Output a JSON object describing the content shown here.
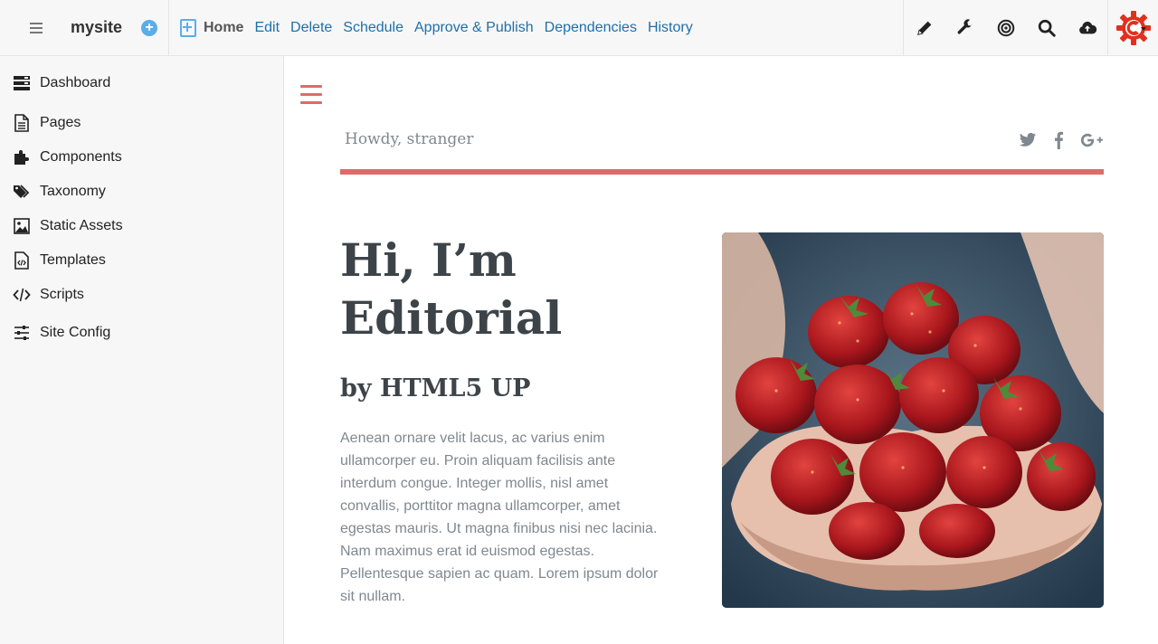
{
  "toolbar": {
    "site_name": "mysite",
    "add_symbol": "+",
    "page_label": "Home",
    "actions": [
      "Edit",
      "Delete",
      "Schedule",
      "Approve & Publish",
      "Dependencies",
      "History"
    ],
    "icons": [
      "pencil-icon",
      "wrench-icon",
      "target-icon",
      "search-icon",
      "cloud-upload-icon"
    ],
    "accent": "#1f6fa8"
  },
  "sidebar": {
    "items": [
      {
        "label": "Dashboard",
        "icon": "dashboard-icon"
      },
      {
        "label": "Pages",
        "icon": "page-icon"
      },
      {
        "label": "Components",
        "icon": "puzzle-icon"
      },
      {
        "label": "Taxonomy",
        "icon": "tags-icon"
      },
      {
        "label": "Static Assets",
        "icon": "image-icon"
      },
      {
        "label": "Templates",
        "icon": "code-file-icon"
      },
      {
        "label": "Scripts",
        "icon": "code-icon"
      },
      {
        "label": "Site Config",
        "icon": "sliders-icon"
      }
    ]
  },
  "preview": {
    "greeting": "Howdy, stranger",
    "social": [
      "twitter-icon",
      "facebook-icon",
      "google-plus-icon"
    ],
    "heading": "Hi, I’m Editorial",
    "subheading": "by HTML5 UP",
    "body": "Aenean ornare velit lacus, ac varius enim ullamcorper eu. Proin aliquam facilisis ante interdum congue. Integer mollis, nisl amet convallis, porttitor magna ullamcorper, amet egestas mauris. Ut magna finibus nisi nec lacinia. Nam maximus erat id euismod egestas. Pellentesque sapien ac quam. Lorem ipsum dolor sit nullam.",
    "accent": "#e06a6a"
  }
}
